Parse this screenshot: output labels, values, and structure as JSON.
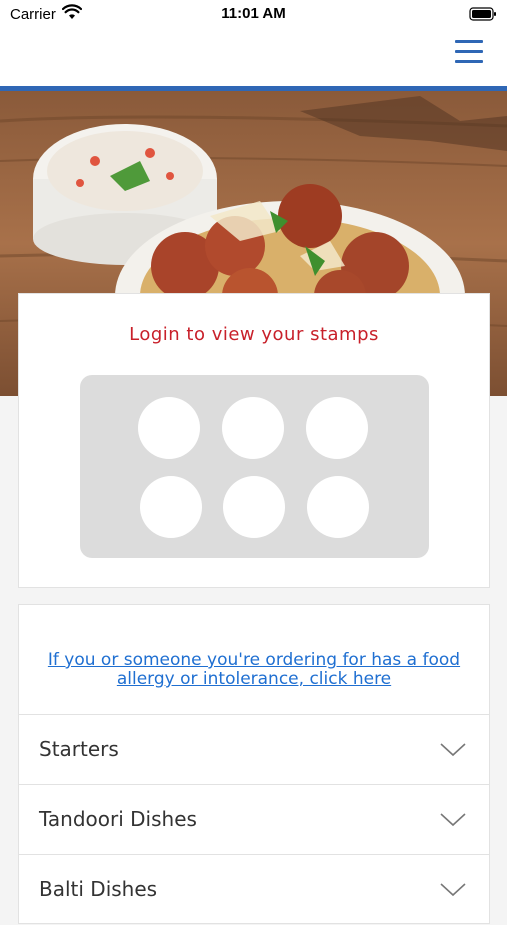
{
  "status_bar": {
    "carrier": "Carrier",
    "time": "11:01 AM"
  },
  "header": {
    "menu_icon": "hamburger-menu-icon"
  },
  "colors": {
    "accent": "#2f67b5",
    "stamp_title": "#c8202a",
    "link": "#1f6fd1"
  },
  "hero": {
    "image": "tandoori-chicken-biryani-raita-photo"
  },
  "stamps": {
    "title": "Login to view your stamps",
    "count": 6
  },
  "allergy": {
    "text": "If you or someone you're ordering for has a food allergy or intolerance, click here"
  },
  "menu": {
    "categories": [
      {
        "label": "Starters"
      },
      {
        "label": "Tandoori Dishes"
      },
      {
        "label": "Balti Dishes"
      }
    ]
  }
}
